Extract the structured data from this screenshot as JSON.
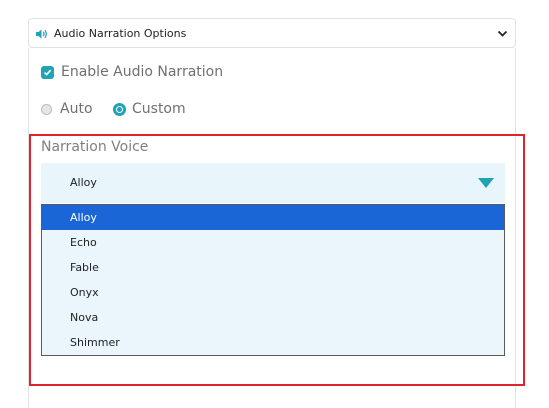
{
  "panel": {
    "title": "Audio Narration Options",
    "icon": "speaker-icon",
    "expand_icon": "chevron-down-icon"
  },
  "enable_narration": {
    "label": "Enable Audio Narration",
    "checked": true
  },
  "mode": {
    "options": [
      {
        "label": "Auto",
        "selected": false
      },
      {
        "label": "Custom",
        "selected": true
      }
    ]
  },
  "voice": {
    "label": "Narration Voice",
    "selected": "Alloy",
    "options": [
      "Alloy",
      "Echo",
      "Fable",
      "Onyx",
      "Nova",
      "Shimmer"
    ]
  },
  "colors": {
    "accent": "#1fa3b5",
    "selected_option": "#1a66d6",
    "highlight_border": "#e0242c",
    "dropdown_bg": "#e8f5fb"
  }
}
